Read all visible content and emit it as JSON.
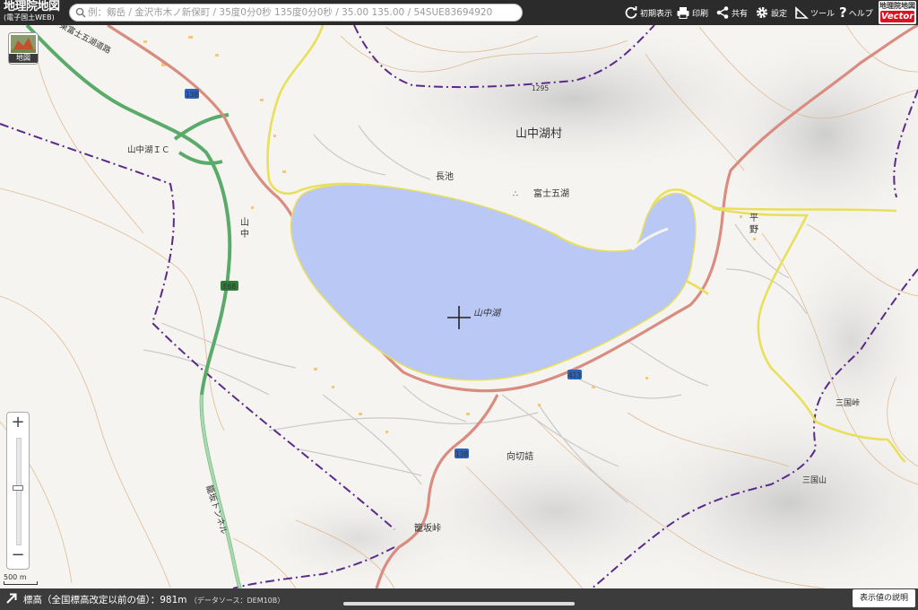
{
  "header": {
    "app_title": "地理院地図",
    "app_subtitle": "(電子国土WEB)",
    "search_placeholder": "例：剱岳 / 金沢市木ノ新保町 / 35度0分0秒 135度0分0秒 / 35.00 135.00 / 54SUE83694920",
    "tools": [
      {
        "label": "初期表示",
        "icon": "refresh-icon"
      },
      {
        "label": "印刷",
        "icon": "printer-icon"
      },
      {
        "label": "共有",
        "icon": "share-icon"
      },
      {
        "label": "設定",
        "icon": "gear-icon"
      },
      {
        "label": "ツール",
        "icon": "ruler-icon"
      },
      {
        "label": "ヘルプ",
        "icon": "question-icon"
      }
    ],
    "vector_badge_top": "地理院地図",
    "vector_badge_bottom": "Vector"
  },
  "layer_button": {
    "label": "地図"
  },
  "zoom": {
    "plus": "+",
    "minus": "−",
    "level_fraction": 0.47
  },
  "scale": {
    "label": "500 m"
  },
  "map": {
    "labels": {
      "village": "山中湖村",
      "lake": "山中湖",
      "nagaike": "長池",
      "fuji_five_lakes": "富士五湖",
      "hirano_1": "平",
      "hirano_2": "野",
      "yamanaka_1": "山",
      "yamanaka_2": "中",
      "ic": "山中湖ＩＣ",
      "kagosaka_tunnel": "籠坂トンネル",
      "kagosaka_pass": "籠坂峠",
      "mukaikirizume": "向切詰",
      "mikuni_pass": "三国峠",
      "mikuniyama": "三国山",
      "higashifuji": "東富士五湖道路",
      "elev_1295": "1295"
    },
    "route_shields": [
      "138",
      "413",
      "138"
    ],
    "expressway_shield": "E68"
  },
  "status": {
    "elevation_label": "標高（全国標高改定以前の値）：",
    "elevation_value": "981m",
    "data_source": "（データソース：DEM10B）",
    "explain_button": "表示値の説明"
  },
  "colors": {
    "lake": "#b9c8f4",
    "national_road": "#d98c80",
    "prefectural_road": "#e6e055",
    "expressway": "#5aab6a",
    "boundary": "#5a2a8a",
    "contour": "#d8a878"
  }
}
